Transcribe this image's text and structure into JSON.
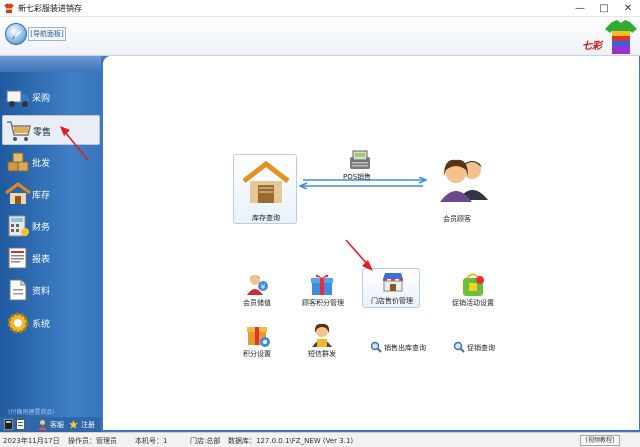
{
  "window": {
    "title": "新七彩服装进销存",
    "minimize": "—",
    "maximize": "□",
    "close": "✕"
  },
  "header": {
    "nav_tab": "[导航面板]",
    "brand": "七彩"
  },
  "sidebar": {
    "items": [
      {
        "label": "采购",
        "icon": "truck-icon"
      },
      {
        "label": "零售",
        "icon": "shopping-cart-icon"
      },
      {
        "label": "批发",
        "icon": "boxes-icon"
      },
      {
        "label": "库存",
        "icon": "warehouse-icon"
      },
      {
        "label": "财务",
        "icon": "calculator-icon"
      },
      {
        "label": "报表",
        "icon": "report-icon"
      },
      {
        "label": "资料",
        "icon": "document-icon"
      },
      {
        "label": "系统",
        "icon": "gear-icon"
      }
    ],
    "active_index": 1,
    "hint": "(付确则建置商品)",
    "footer": {
      "service": "客服",
      "register": "注册"
    }
  },
  "main": {
    "pos_label": "POS销售",
    "inventory_query": "库存查询",
    "member_customer": "会员顾客",
    "items": [
      {
        "label": "会员储值",
        "icon": "member-savings-icon"
      },
      {
        "label": "顾客积分管理",
        "icon": "gift-icon"
      },
      {
        "label": "门店售价管理",
        "icon": "store-icon"
      },
      {
        "label": "促销活动设置",
        "icon": "promotion-icon"
      },
      {
        "label": "积分设置",
        "icon": "points-gift-icon"
      },
      {
        "label": "短信群发",
        "icon": "sms-person-icon"
      },
      {
        "label": "销售出库查询",
        "icon": "search-icon"
      },
      {
        "label": "促销查询",
        "icon": "search-icon"
      }
    ]
  },
  "status": {
    "date": "2023年11月17日",
    "operator": "操作员：管理员",
    "machine": "本机号：1",
    "store": "门店:总部",
    "database": "数据库：127.0.0.1\\FZ_NEW (Ver 3.1)",
    "tutorial": "[视频教程]"
  },
  "colors": {
    "sidebar": "#2f67ab",
    "accent": "#c81818",
    "arrow": "#e02020"
  }
}
